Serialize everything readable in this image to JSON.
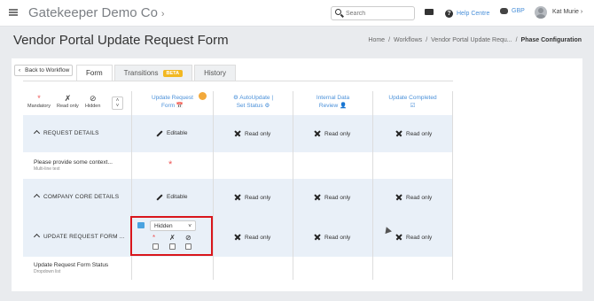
{
  "topbar": {
    "company": "Gatekeeper Demo Co",
    "search_placeholder": "Search",
    "help_label": "Help Centre",
    "currency": "GBP",
    "user_name": "Kat Murie"
  },
  "page": {
    "title": "Vendor Portal Update Request Form",
    "breadcrumb": [
      "Home",
      "/",
      "Workflows",
      "/",
      "Vendor Portal Update Requ...",
      "/",
      "Phase Configuration"
    ]
  },
  "back_button": "Back to Workflow",
  "tabs": [
    {
      "label": "Form",
      "active": true
    },
    {
      "label": "Transitions",
      "badge": "BETA"
    },
    {
      "label": "History"
    }
  ],
  "legend": {
    "mandatory": "Mandatory",
    "read_only": "Read only",
    "hidden": "Hidden"
  },
  "columns": [
    {
      "line1": "Update Request",
      "line2": "Form 📅"
    },
    {
      "line1": "⚙ AutoUpdate |",
      "line2": "Set Status ⚙"
    },
    {
      "line1": "Internal Data",
      "line2": "Review 👤"
    },
    {
      "line1": "Update Completed",
      "line2": "☑"
    }
  ],
  "rows": {
    "request_details": {
      "label": "REQUEST DETAILS",
      "cells": [
        "Editable",
        "Read only",
        "Read only",
        "Read only"
      ]
    },
    "context_field": {
      "label": "Please provide some context...",
      "type": "Multi-line text"
    },
    "company_core": {
      "label": "COMPANY CORE DETAILS",
      "cells": [
        "Editable",
        "Read only",
        "Read only",
        "Read only"
      ]
    },
    "update_request": {
      "label": "UPDATE REQUEST FORM ...",
      "select_value": "Hidden",
      "cells": [
        "Read only",
        "Read only",
        "Read only"
      ]
    },
    "status_field": {
      "label": "Update Request Form Status",
      "type": "Dropdown list"
    }
  },
  "colors": {
    "accent": "#4a90d9",
    "highlight": "#d9161c",
    "beta": "#f2b822"
  }
}
